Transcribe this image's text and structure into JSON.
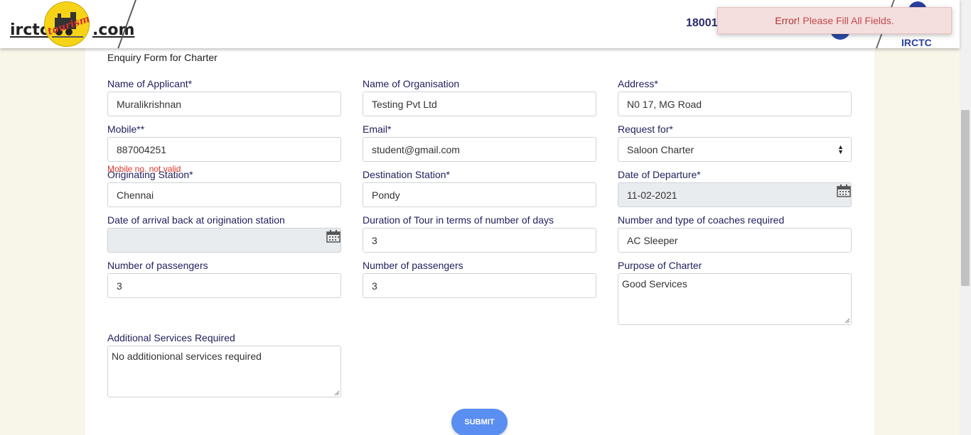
{
  "header": {
    "logo_left": "irctc",
    "logo_right": ".com",
    "logo_tourism": "tourism",
    "phone": "18001",
    "brand": "IRCTC"
  },
  "toast": {
    "strong": "Error!",
    "message": "Please Fill All Fields."
  },
  "form": {
    "title": "Enquiry Form for Charter",
    "fields": {
      "applicant": {
        "label": "Name of Applicant*",
        "value": "Muralikrishnan"
      },
      "organisation": {
        "label": "Name of Organisation",
        "value": "Testing Pvt Ltd"
      },
      "address": {
        "label": "Address*",
        "value": "N0 17, MG Road"
      },
      "mobile": {
        "label": "Mobile**",
        "value": "887004251",
        "error": "Mobile no. not valid"
      },
      "email": {
        "label": "Email*",
        "value": "student@gmail.com"
      },
      "request_for": {
        "label": "Request for*",
        "value": "Saloon Charter"
      },
      "origin": {
        "label": "Originating Station*",
        "value": "Chennai"
      },
      "destination": {
        "label": "Destination Station*",
        "value": "Pondy"
      },
      "departure": {
        "label": "Date of Departure*",
        "value": "11-02-2021"
      },
      "arrival_back": {
        "label": "Date of arrival back at origination station",
        "value": ""
      },
      "duration": {
        "label": "Duration of Tour in terms of number of days",
        "value": "3"
      },
      "coaches": {
        "label": "Number and type of coaches required",
        "value": "AC Sleeper"
      },
      "passengers1": {
        "label": "Number of passengers",
        "value": "3"
      },
      "passengers2": {
        "label": "Number of passengers",
        "value": "3"
      },
      "purpose": {
        "label": "Purpose of Charter",
        "value": "Good Services"
      },
      "additional": {
        "label": "Additional Services Required",
        "value": "No additionional services required"
      }
    },
    "submit_label": "SUBMIT"
  },
  "colors": {
    "label": "#1f1f5c",
    "error": "#e0352b",
    "submit": "#5a8ef0",
    "toast_bg": "#f5dede"
  }
}
